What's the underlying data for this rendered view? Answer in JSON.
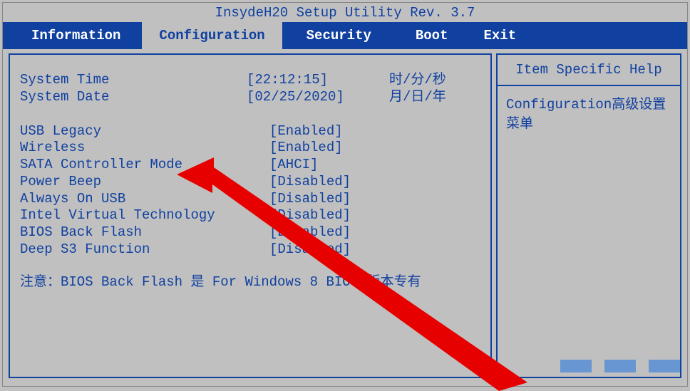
{
  "title": "InsydeH20 Setup Utility Rev. 3.7",
  "tabs": [
    {
      "key": "information",
      "label": "Information",
      "active": false
    },
    {
      "key": "configuration",
      "label": "Configuration",
      "active": true
    },
    {
      "key": "security",
      "label": "Security",
      "active": false
    },
    {
      "key": "boot",
      "label": "Boot",
      "active": false
    },
    {
      "key": "exit",
      "label": "Exit",
      "active": false
    }
  ],
  "time": {
    "label": "System Time",
    "value": "[22:12:15]",
    "suffix": "时/分/秒"
  },
  "date": {
    "label": "System Date",
    "value": "[02/25/2020]",
    "suffix": "月/日/年"
  },
  "settings": [
    {
      "label": "USB Legacy",
      "value": "[Enabled]"
    },
    {
      "label": "Wireless",
      "value": "[Enabled]"
    },
    {
      "label": "SATA Controller Mode",
      "value": "[AHCI]"
    },
    {
      "label": "Power Beep",
      "value": "[Disabled]"
    },
    {
      "label": "Always On USB",
      "value": "[Disabled]"
    },
    {
      "label": "Intel Virtual Technology",
      "value": "[Disabled]"
    },
    {
      "label": "BIOS Back Flash",
      "value": "[Disabled]"
    },
    {
      "label": "Deep S3 Function",
      "value": "[Disabled]"
    }
  ],
  "note": "注意：BIOS Back Flash 是 For Windows 8 BIOS 版本专有",
  "help": {
    "header": "Item Specific Help",
    "body": "Configuration高级设置菜单"
  }
}
